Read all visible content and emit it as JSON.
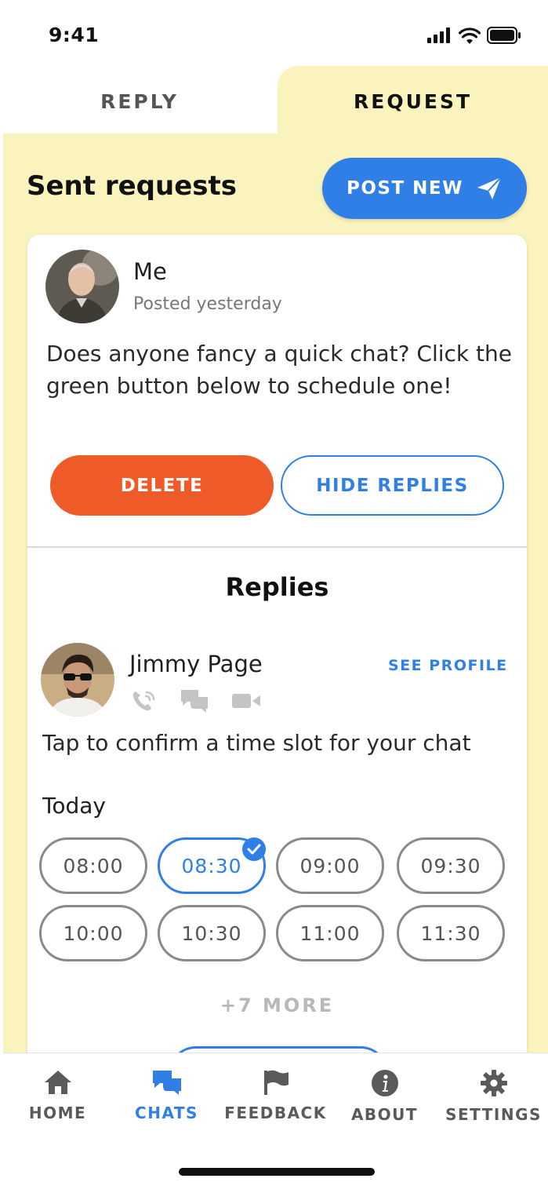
{
  "status_bar": {
    "time": "9:41"
  },
  "tabs": [
    {
      "label": "REPLY",
      "active": false
    },
    {
      "label": "REQUEST",
      "active": true
    }
  ],
  "header": {
    "title": "Sent requests",
    "post_new_label": "POST NEW"
  },
  "post": {
    "author": "Me",
    "posted": "Posted yesterday",
    "body": "Does anyone fancy a quick chat? Click the green button below to schedule one!",
    "delete_label": "DELETE",
    "hide_replies_label": "HIDE REPLIES"
  },
  "replies": {
    "title": "Replies",
    "reply": {
      "name": "Jimmy Page",
      "see_profile_label": "SEE PROFILE",
      "contact_icons": [
        "phone-icon",
        "chat-icon",
        "video-icon"
      ],
      "instruction": "Tap to confirm a time slot for your chat",
      "day_label": "Today",
      "slots": [
        {
          "time": "08:00",
          "selected": false
        },
        {
          "time": "08:30",
          "selected": true
        },
        {
          "time": "09:00",
          "selected": false
        },
        {
          "time": "09:30",
          "selected": false
        },
        {
          "time": "10:00",
          "selected": false
        },
        {
          "time": "10:30",
          "selected": false
        },
        {
          "time": "11:00",
          "selected": false
        },
        {
          "time": "11:30",
          "selected": false
        }
      ],
      "more_label": "+7 MORE"
    }
  },
  "bottom_nav": [
    {
      "label": "HOME",
      "icon": "home-icon",
      "active": false
    },
    {
      "label": "CHATS",
      "icon": "chats-icon",
      "active": true
    },
    {
      "label": "FEEDBACK",
      "icon": "flag-icon",
      "active": false
    },
    {
      "label": "ABOUT",
      "icon": "info-icon",
      "active": false
    },
    {
      "label": "SETTINGS",
      "icon": "gear-icon",
      "active": false
    }
  ],
  "colors": {
    "accent": "#2f7fe6",
    "danger": "#ef5b28",
    "panel_background": "#fbf3bd"
  }
}
